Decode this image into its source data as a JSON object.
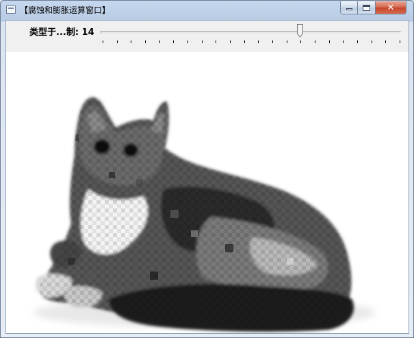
{
  "window": {
    "title": "【腐蚀和膨胀运算窗口】",
    "controls": {
      "minimize": "minimize",
      "maximize": "maximize",
      "close": "✕"
    }
  },
  "trackbar": {
    "label": "类型于...制: 14",
    "value": 14,
    "max": 21,
    "tick_count": 22
  },
  "image": {
    "description_icon": "cat-photo",
    "background": "#ffffff"
  },
  "colors": {
    "titlebar": "#c6d8ee",
    "close_button": "#c4432a",
    "client_bg": "#f0f0f0"
  }
}
